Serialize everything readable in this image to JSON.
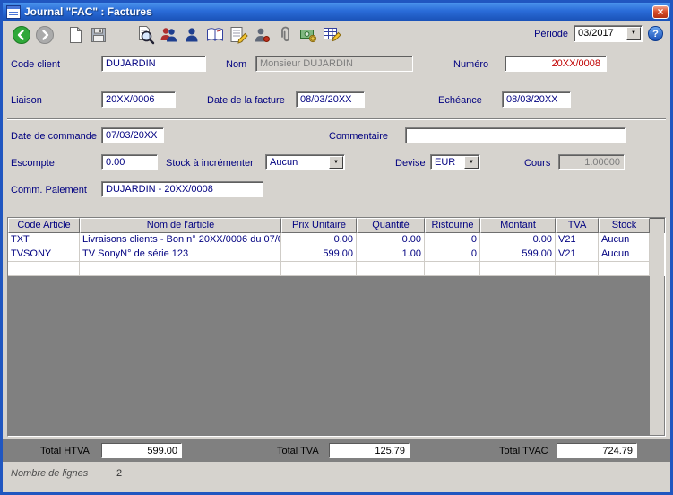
{
  "colors": {
    "window_border": "#2056C0",
    "title_gradient_top": "#4A93EC",
    "title_gradient_bottom": "#1A52B8",
    "face": "#D6D3CE",
    "label_navy": "#000080",
    "numero_red": "#C00000",
    "table_empty_gray": "#808080",
    "totals_band_gray": "#808080"
  },
  "icons": {
    "close": "×",
    "help": "?",
    "dropdown": "▼"
  },
  "window": {
    "title": "Journal \"FAC\" : Factures"
  },
  "toolbar": {
    "period_label": "Période",
    "period_value": "03/2017",
    "buttons": [
      "back",
      "forward",
      "new-document",
      "save",
      "preview",
      "clients",
      "client",
      "journal-book",
      "entries",
      "contact",
      "attachments",
      "payment",
      "table-edit"
    ]
  },
  "form": {
    "code_client": {
      "label": "Code client",
      "value": "DUJARDIN"
    },
    "nom": {
      "label": "Nom",
      "value": "Monsieur DUJARDIN"
    },
    "numero": {
      "label": "Numéro",
      "value": "20XX/0008"
    },
    "liaison": {
      "label": "Liaison",
      "value": "20XX/0006"
    },
    "date_facture": {
      "label": "Date de la facture",
      "value": "08/03/20XX"
    },
    "echeance": {
      "label": "Echéance",
      "value": "08/03/20XX"
    },
    "date_commande": {
      "label": "Date de commande",
      "value": "07/03/20XX"
    },
    "commentaire": {
      "label": "Commentaire",
      "value": ""
    },
    "escompte": {
      "label": "Escompte",
      "value": "0.00"
    },
    "stock_incrementer": {
      "label": "Stock à incrémenter",
      "value": "Aucun"
    },
    "devise": {
      "label": "Devise",
      "value": "EUR"
    },
    "cours": {
      "label": "Cours",
      "value": "1.00000"
    },
    "comm_paiement": {
      "label": "Comm. Paiement",
      "value": "DUJARDIN - 20XX/0008"
    }
  },
  "table": {
    "headers": [
      "Code Article",
      "Nom de l'article",
      "Prix Unitaire",
      "Quantité",
      "Ristourne",
      "Montant",
      "TVA",
      "Stock"
    ],
    "rows": [
      [
        "TXT",
        "Livraisons clients - Bon n° 20XX/0006 du 07/0",
        "0.00",
        "0.00",
        "0",
        "0.00",
        "V21",
        "Aucun"
      ],
      [
        "TVSONY",
        "TV SonyN° de série 123",
        "599.00",
        "1.00",
        "0",
        "599.00",
        "V21",
        "Aucun"
      ]
    ]
  },
  "totals": {
    "htva": {
      "label": "Total HTVA",
      "value": "599.00"
    },
    "tva": {
      "label": "Total TVA",
      "value": "125.79"
    },
    "tvac": {
      "label": "Total TVAC",
      "value": "724.79"
    }
  },
  "statusbar": {
    "label": "Nombre de lignes",
    "value": "2"
  }
}
